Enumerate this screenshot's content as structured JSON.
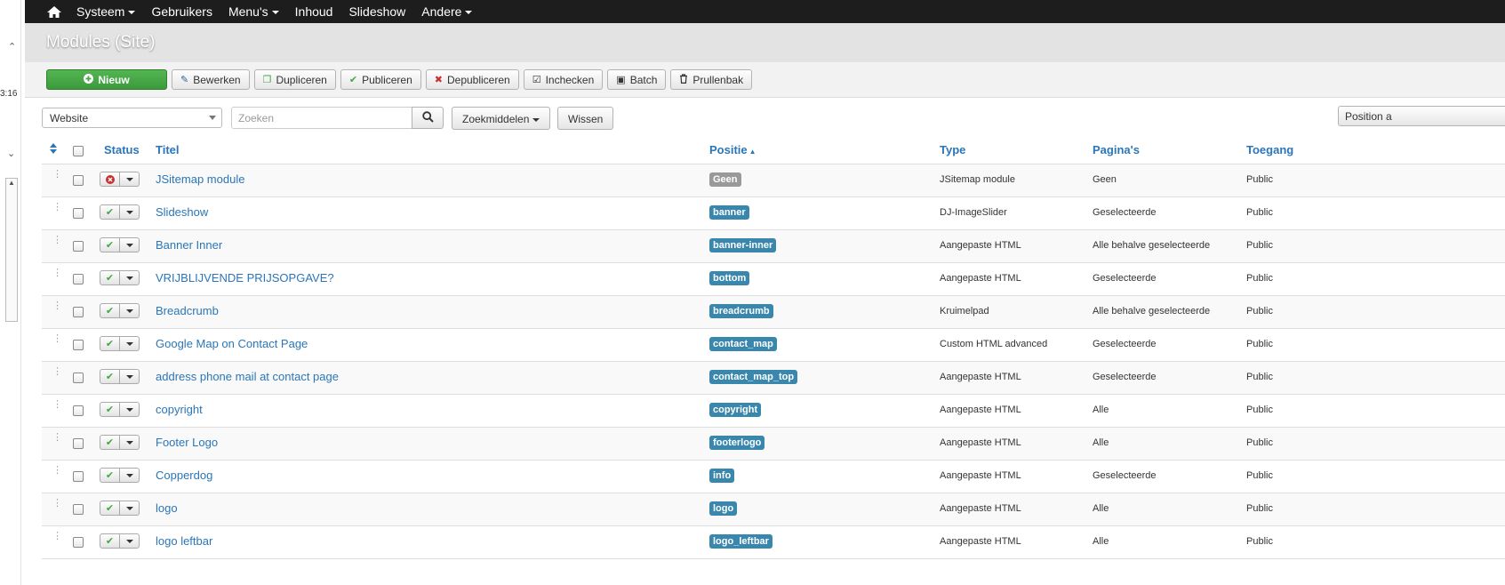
{
  "side": {
    "time": "3:16"
  },
  "topnav": {
    "items": [
      {
        "label": "Systeem",
        "caret": true
      },
      {
        "label": "Gebruikers",
        "caret": false
      },
      {
        "label": "Menu's",
        "caret": true
      },
      {
        "label": "Inhoud",
        "caret": false
      },
      {
        "label": "Slideshow",
        "caret": false
      },
      {
        "label": "Andere",
        "caret": true
      }
    ]
  },
  "page": {
    "title": "Modules (Site)"
  },
  "toolbar": {
    "new_label": "Nieuw",
    "edit_label": "Bewerken",
    "duplicate_label": "Dupliceren",
    "publish_label": "Publiceren",
    "unpublish_label": "Depubliceren",
    "checkin_label": "Inchecken",
    "batch_label": "Batch",
    "trash_label": "Prullenbak"
  },
  "filters": {
    "client_select": "Website",
    "search_placeholder": "Zoeken",
    "search_tools_label": "Zoekmiddelen",
    "clear_label": "Wissen",
    "sort_label": "Position a"
  },
  "table": {
    "headers": {
      "status": "Status",
      "title": "Titel",
      "position": "Positie",
      "type": "Type",
      "pages": "Pagina's",
      "access": "Toegang"
    },
    "rows": [
      {
        "published": false,
        "title": "JSitemap module",
        "position": "Geen",
        "position_none": true,
        "type": "JSitemap module",
        "pages": "Geen",
        "access": "Public"
      },
      {
        "published": true,
        "title": "Slideshow",
        "position": "banner",
        "type": "DJ-ImageSlider",
        "pages": "Geselecteerde",
        "access": "Public"
      },
      {
        "published": true,
        "title": "Banner Inner",
        "position": "banner-inner",
        "type": "Aangepaste HTML",
        "pages": "Alle behalve geselecteerde",
        "access": "Public"
      },
      {
        "published": true,
        "title": "VRIJBLIJVENDE PRIJSOPGAVE?",
        "position": "bottom",
        "type": "Aangepaste HTML",
        "pages": "Geselecteerde",
        "access": "Public"
      },
      {
        "published": true,
        "title": "Breadcrumb",
        "position": "breadcrumb",
        "type": "Kruimelpad",
        "pages": "Alle behalve geselecteerde",
        "access": "Public"
      },
      {
        "published": true,
        "title": "Google Map on Contact Page",
        "position": "contact_map",
        "type": "Custom HTML advanced",
        "pages": "Geselecteerde",
        "access": "Public"
      },
      {
        "published": true,
        "title": "address phone mail at contact page",
        "position": "contact_map_top",
        "type": "Aangepaste HTML",
        "pages": "Geselecteerde",
        "access": "Public"
      },
      {
        "published": true,
        "title": "copyright",
        "position": "copyright",
        "type": "Aangepaste HTML",
        "pages": "Alle",
        "access": "Public"
      },
      {
        "published": true,
        "title": "Footer Logo",
        "position": "footerlogo",
        "type": "Aangepaste HTML",
        "pages": "Alle",
        "access": "Public"
      },
      {
        "published": true,
        "title": "Copperdog",
        "position": "info",
        "type": "Aangepaste HTML",
        "pages": "Geselecteerde",
        "access": "Public"
      },
      {
        "published": true,
        "title": "logo",
        "position": "logo",
        "type": "Aangepaste HTML",
        "pages": "Alle",
        "access": "Public"
      },
      {
        "published": true,
        "title": "logo leftbar",
        "position": "logo_leftbar",
        "type": "Aangepaste HTML",
        "pages": "Alle",
        "access": "Public"
      }
    ]
  },
  "colors": {
    "topnav_bg": "#1d1d1d",
    "new_button": "#46a546",
    "link": "#2a76b8",
    "badge": "#3a87ad",
    "badge_none": "#999999",
    "published": "#46a546",
    "unpublished": "#c83030"
  }
}
